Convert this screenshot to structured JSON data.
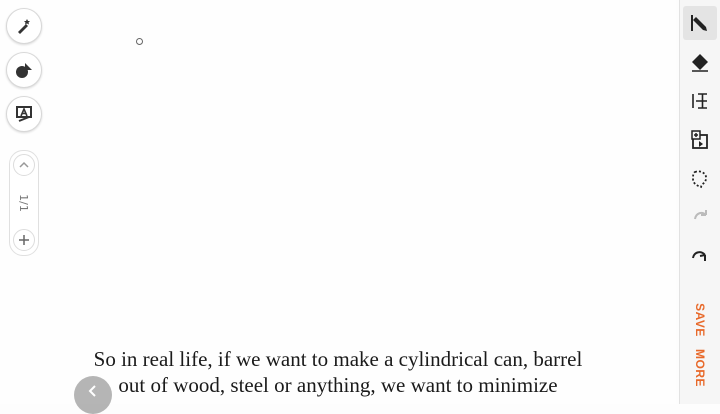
{
  "left_toolbar": {
    "buttons": [
      {
        "icon": "magic-pen-icon"
      },
      {
        "icon": "shape-recognition-icon"
      },
      {
        "icon": "text-recognition-icon"
      }
    ],
    "pager": {
      "page_indicator": "1/1",
      "prev_icon": "chevron-up-icon",
      "add_icon": "plus-icon"
    }
  },
  "right_toolbar": {
    "tools": [
      {
        "icon": "pen-icon",
        "active": true
      },
      {
        "icon": "eraser-icon"
      },
      {
        "icon": "text-cursor-icon"
      },
      {
        "icon": "insert-image-icon"
      },
      {
        "icon": "lasso-select-icon"
      },
      {
        "icon": "undo-icon"
      },
      {
        "icon": "redo-icon"
      }
    ],
    "save_label": "SAVE",
    "more_label": "MORE",
    "accent_color": "#e8692a"
  },
  "subtitle": {
    "line1": "So in real life, if we want to make a cylindrical can, barrel",
    "line2": "out of wood, steel or anything, we want to minimize"
  },
  "overlay": {
    "icon": "back-chevron-icon"
  }
}
